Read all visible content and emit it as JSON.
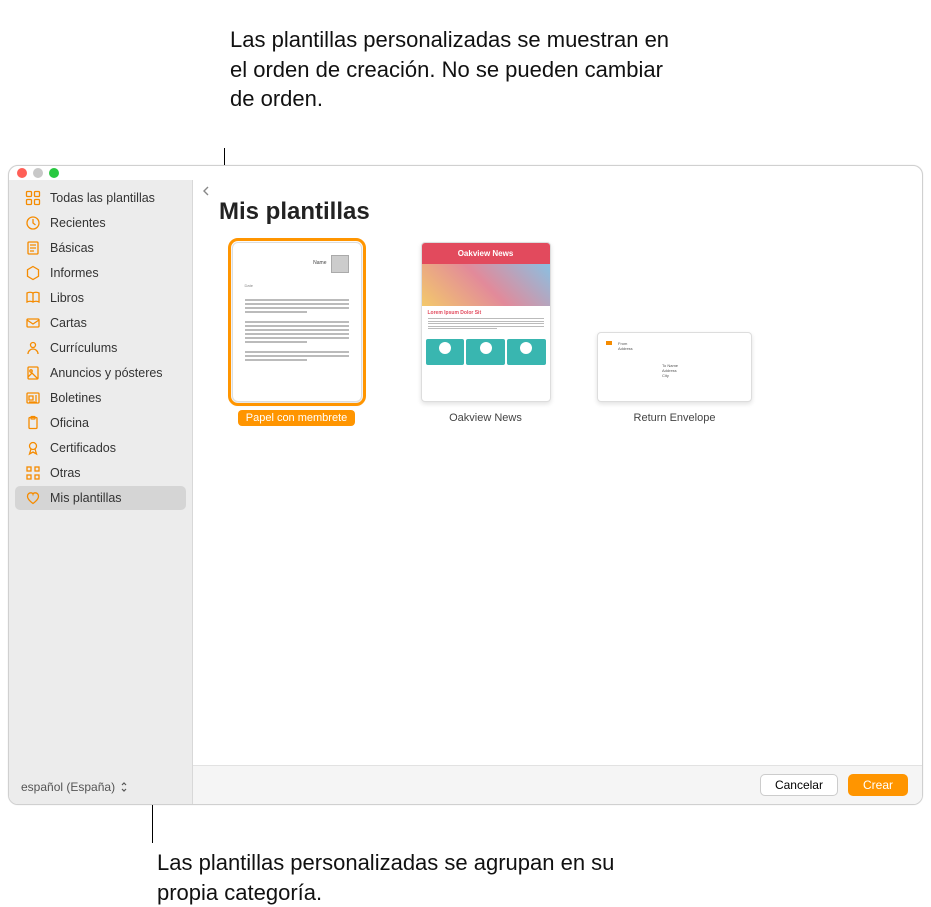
{
  "annotations": {
    "top": "Las plantillas personalizadas se muestran en el orden de creación. No se pueden cambiar de orden.",
    "bottom": "Las plantillas personalizadas se agrupan en su propia categoría."
  },
  "sidebar": {
    "items": [
      {
        "label": "Todas las plantillas",
        "icon": "grid"
      },
      {
        "label": "Recientes",
        "icon": "clock"
      },
      {
        "label": "Básicas",
        "icon": "doc"
      },
      {
        "label": "Informes",
        "icon": "hex"
      },
      {
        "label": "Libros",
        "icon": "book"
      },
      {
        "label": "Cartas",
        "icon": "envelope"
      },
      {
        "label": "Currículums",
        "icon": "person"
      },
      {
        "label": "Anuncios y pósteres",
        "icon": "poster"
      },
      {
        "label": "Boletines",
        "icon": "newspaper"
      },
      {
        "label": "Oficina",
        "icon": "clipboard"
      },
      {
        "label": "Certificados",
        "icon": "award"
      },
      {
        "label": "Otras",
        "icon": "grid2"
      },
      {
        "label": "Mis plantillas",
        "icon": "heart"
      }
    ],
    "selected_index": 12
  },
  "language": {
    "label": "español (España)"
  },
  "main": {
    "title": "Mis plantillas",
    "templates": [
      {
        "label": "Papel con membrete",
        "kind": "letterhead",
        "selected": true
      },
      {
        "label": "Oakview News",
        "kind": "newsletter",
        "selected": false,
        "header_text": "Oakview News",
        "sub_text": "Lorem Ipsum Dolor Sit"
      },
      {
        "label": "Return Envelope",
        "kind": "envelope",
        "selected": false
      }
    ]
  },
  "footer": {
    "cancel": "Cancelar",
    "create": "Crear"
  }
}
